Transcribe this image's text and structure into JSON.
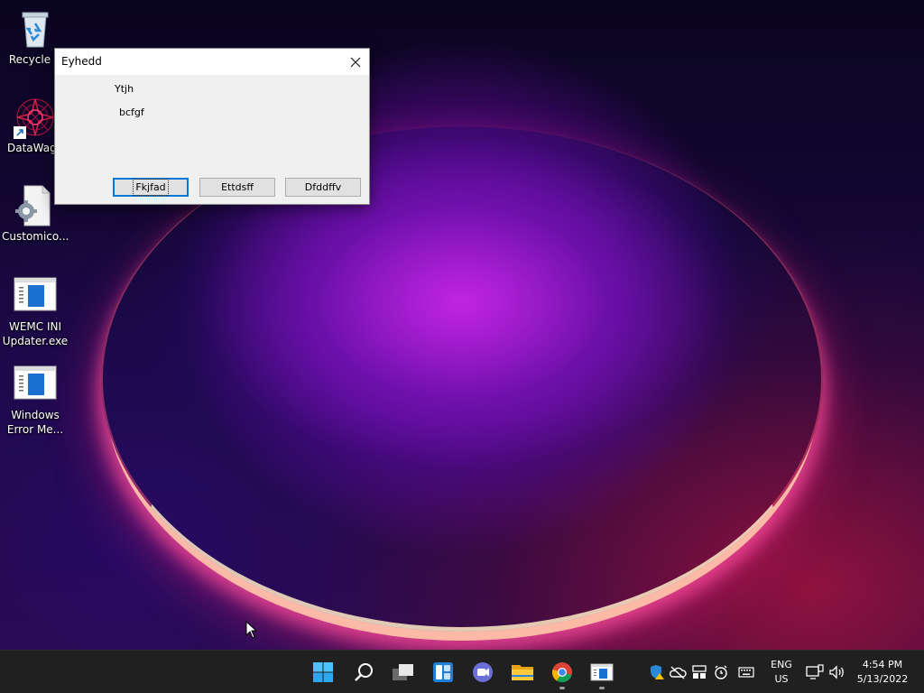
{
  "desktop": {
    "icons": [
      {
        "label": "Recycle B",
        "icon": "recycle-bin-icon"
      },
      {
        "label": "DataWago",
        "icon": "datawago-icon"
      },
      {
        "label": "Customico...",
        "icon": "settings-file-icon"
      },
      {
        "label": "WEMC INI\nUpdater.exe",
        "icon": "exe-window-icon"
      },
      {
        "label": "Windows\nError Me...",
        "icon": "exe-window-icon"
      }
    ]
  },
  "dialog": {
    "title": "Eyhedd",
    "line1": "Ytjh",
    "line2": "bcfgf",
    "buttons": [
      "Fkjfad",
      "Ettdsff",
      "Dfddffv"
    ]
  },
  "taskbar": {
    "apps": [
      "start-icon",
      "search-icon",
      "task-view-icon",
      "widgets-icon",
      "chat-icon",
      "file-explorer-icon",
      "chrome-icon",
      "app-window-icon"
    ],
    "language": {
      "line1": "ENG",
      "line2": "US"
    },
    "clock": {
      "time": "4:54 PM",
      "date": "5/13/2022"
    }
  },
  "colors": {
    "accent": "#0078d7",
    "taskbar": "#202020",
    "dialog_bg": "#f0f0f0"
  }
}
